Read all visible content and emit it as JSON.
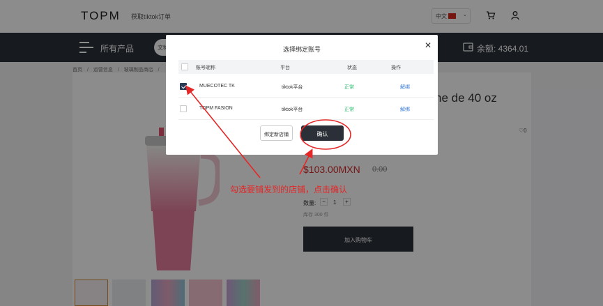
{
  "header": {
    "logo": "TOPM",
    "order_link": "获取tiktok订单",
    "language": "中文"
  },
  "nav": {
    "all_products": "所有产品",
    "search_pill": "文物",
    "balance": "余额: 4364.01"
  },
  "breadcrumb": [
    "首页",
    "/",
    "运营信息",
    "/",
    "玻璃制品商店",
    "/"
  ],
  "product": {
    "title_fragment": "he de 40 oz",
    "favorites": "0",
    "price": "$103.00MXN",
    "old_price": "0.00",
    "quantity_label": "数量:",
    "quantity": "1",
    "stock": "库存 300 件",
    "add_to_cart": "加入购物车"
  },
  "annotation": {
    "note": "勾选要铺发到的店铺，点击确认",
    "color": "#e52727"
  },
  "modal": {
    "title": "选择绑定账号",
    "columns": [
      "账号昵称",
      "平台",
      "状态",
      "操作"
    ],
    "rows": [
      {
        "name": "MUECOTEC TK",
        "platform": "tiktok平台",
        "status": "正常",
        "action": "解绑",
        "checked": true
      },
      {
        "name": "TOPM FASION",
        "platform": "tiktok平台",
        "status": "正常",
        "action": "解绑",
        "checked": false
      }
    ],
    "bind_button": "绑定新店铺",
    "confirm_button": "确认"
  },
  "colors": {
    "nav_bg": "#2b3038",
    "status_ok": "#2fbf71",
    "link": "#3a7bd5",
    "price": "#d02a2a"
  }
}
